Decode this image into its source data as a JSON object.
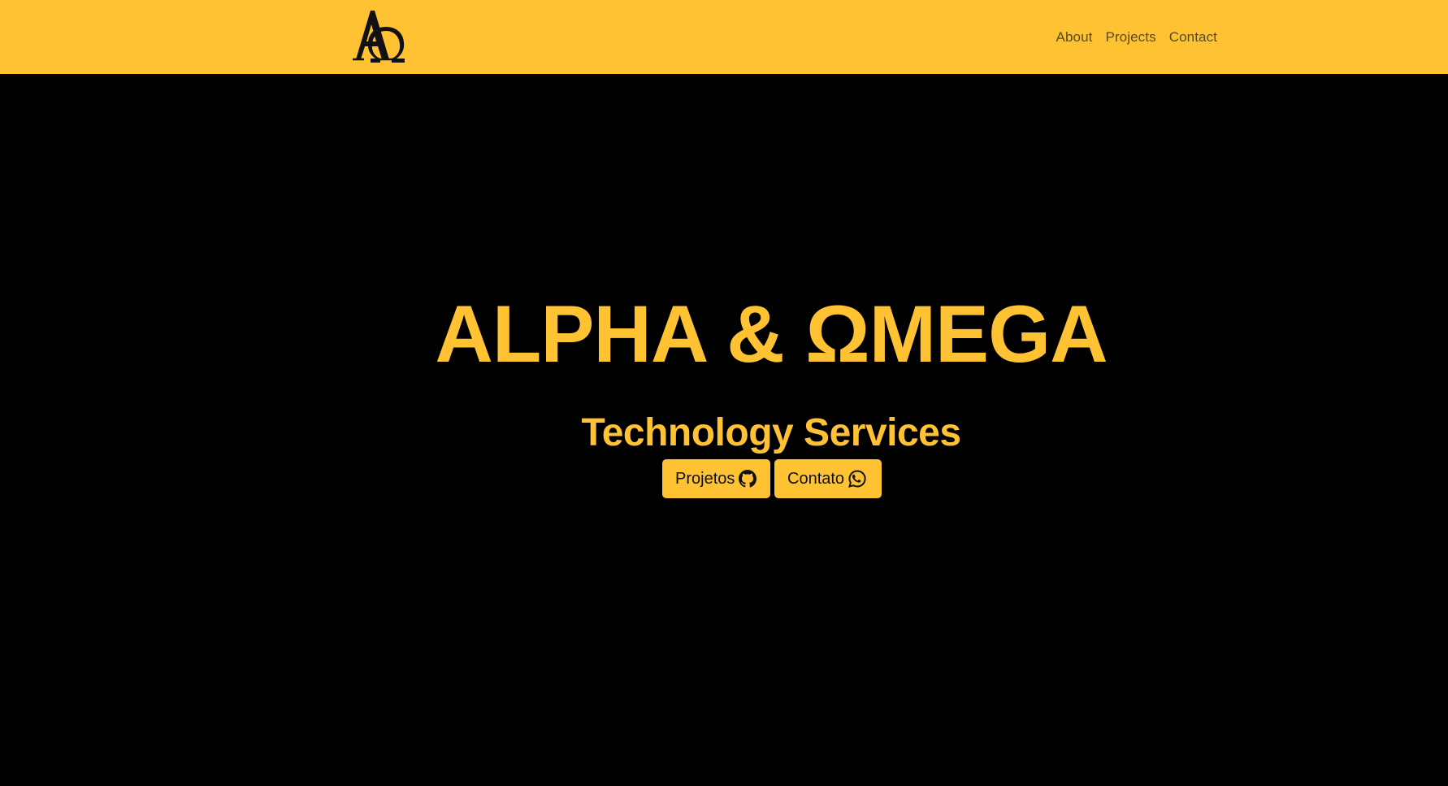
{
  "navbar": {
    "logo_icon": "alpha-omega-logo-icon",
    "links": [
      {
        "label": "About"
      },
      {
        "label": "Projects"
      },
      {
        "label": "Contact"
      }
    ]
  },
  "hero": {
    "title": "ALPHA & ΩMEGA",
    "subtitle": "Technology Services",
    "buttons": [
      {
        "label": "Projetos",
        "icon": "github-icon"
      },
      {
        "label": "Contato",
        "icon": "whatsapp-icon"
      }
    ]
  },
  "colors": {
    "accent": "#FFC232",
    "background": "#000000",
    "nav_text": "#5b4a1e",
    "button_text": "#111111"
  }
}
